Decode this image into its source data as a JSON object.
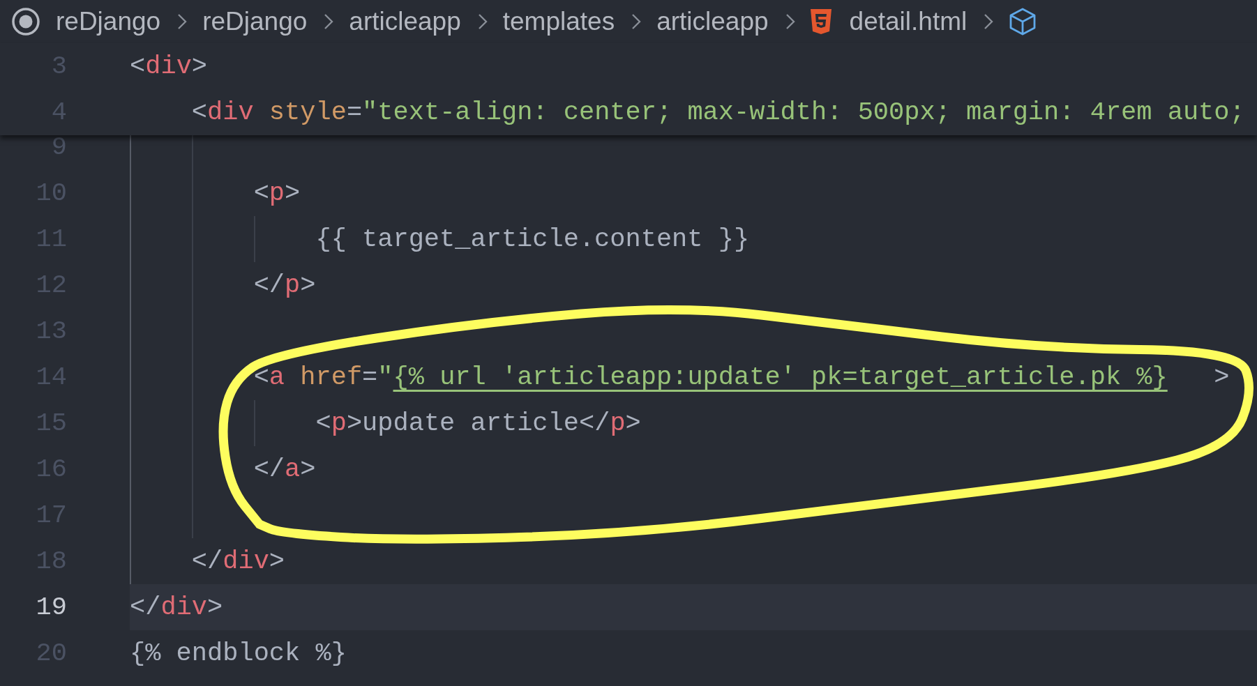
{
  "breadcrumb": {
    "items": [
      {
        "label": "reDjango",
        "kind": "folder"
      },
      {
        "label": "reDjango",
        "kind": "folder"
      },
      {
        "label": "articleapp",
        "kind": "folder"
      },
      {
        "label": "templates",
        "kind": "folder"
      },
      {
        "label": "articleapp",
        "kind": "folder"
      },
      {
        "label": "detail.html",
        "kind": "html-file"
      }
    ]
  },
  "lines": [
    {
      "number": "3",
      "sticky": true,
      "tokens": [
        {
          "kind": "punct",
          "text": "<"
        },
        {
          "kind": "tag",
          "text": "div"
        },
        {
          "kind": "punct",
          "text": ">"
        }
      ],
      "children": [
        {
          "number": "4",
          "sticky": true,
          "tokens": [
            {
              "kind": "punct",
              "text": "<"
            },
            {
              "kind": "tag",
              "text": "div"
            },
            {
              "kind": "attr",
              "text": " style"
            },
            {
              "kind": "punct",
              "text": "="
            },
            {
              "kind": "string",
              "text": "\"text-align: center; max-width: 500px; margin: 4rem auto;"
            }
          ],
          "children": [
            {
              "number": "9"
            },
            {
              "number": "10",
              "tokens": [
                {
                  "kind": "punct",
                  "text": "<"
                },
                {
                  "kind": "tag",
                  "text": "p"
                },
                {
                  "kind": "punct",
                  "text": ">"
                }
              ],
              "children": [
                {
                  "number": "11",
                  "tokens": [
                    {
                      "kind": "text",
                      "text": "{{ target_article.content }}"
                    }
                  ]
                }
              ]
            },
            {
              "number": "12",
              "tokens": [
                {
                  "kind": "punct",
                  "text": "</"
                },
                {
                  "kind": "tag",
                  "text": "p"
                },
                {
                  "kind": "punct",
                  "text": ">"
                }
              ]
            },
            {
              "number": "13"
            },
            {
              "number": "14",
              "tokens": [
                {
                  "kind": "punct",
                  "text": "<"
                },
                {
                  "kind": "tag",
                  "text": "a"
                },
                {
                  "kind": "attr",
                  "text": " href"
                },
                {
                  "kind": "punct",
                  "text": "="
                },
                {
                  "kind": "string",
                  "text": "\""
                },
                {
                  "kind": "link",
                  "text": "{% url 'articleapp:update' pk=target_article.pk %}"
                },
                {
                  "kind": "punct",
                  "text": "   >"
                }
              ],
              "children": [
                {
                  "number": "15",
                  "tokens": [
                    {
                      "kind": "punct",
                      "text": "<"
                    },
                    {
                      "kind": "tag",
                      "text": "p"
                    },
                    {
                      "kind": "punct",
                      "text": ">"
                    },
                    {
                      "kind": "text",
                      "text": "update article"
                    },
                    {
                      "kind": "punct",
                      "text": "</"
                    },
                    {
                      "kind": "tag",
                      "text": "p"
                    },
                    {
                      "kind": "punct",
                      "text": ">"
                    }
                  ]
                }
              ]
            },
            {
              "number": "16",
              "tokens": [
                {
                  "kind": "punct",
                  "text": "</"
                },
                {
                  "kind": "tag",
                  "text": "a"
                },
                {
                  "kind": "punct",
                  "text": ">"
                }
              ]
            },
            {
              "number": "17"
            }
          ]
        },
        {
          "number": "18",
          "tokens": [
            {
              "kind": "punct",
              "text": "</"
            },
            {
              "kind": "tag",
              "text": "div"
            },
            {
              "kind": "punct",
              "text": ">"
            }
          ]
        }
      ]
    },
    {
      "number": "19",
      "current": true,
      "tokens": [
        {
          "kind": "punct",
          "text": "</"
        },
        {
          "kind": "tag",
          "text": "div"
        },
        {
          "kind": "punct",
          "text": ">"
        }
      ]
    },
    {
      "number": "20",
      "tokens": [
        {
          "kind": "text",
          "text": "{% endblock %}"
        }
      ]
    }
  ]
}
